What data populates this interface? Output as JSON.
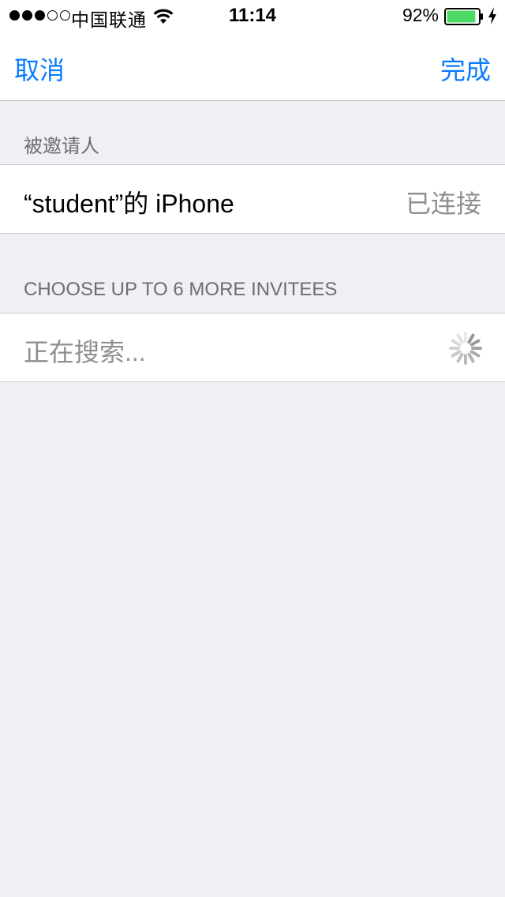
{
  "status_bar": {
    "carrier": "中国联通",
    "time": "11:14",
    "battery_percent": "92%",
    "battery_level": 0.92,
    "signal_bars": 3,
    "signal_total": 5,
    "icons": [
      "wifi-icon",
      "battery-icon",
      "charging-icon"
    ]
  },
  "nav": {
    "cancel_label": "取消",
    "done_label": "完成"
  },
  "invited_section": {
    "header": "被邀请人",
    "items": [
      {
        "name": "“student”的 iPhone",
        "status": "已连接"
      }
    ]
  },
  "more_section": {
    "header": "CHOOSE UP TO 6 MORE INVITEES",
    "searching_label": "正在搜索...",
    "icon": "spinner-icon"
  },
  "colors": {
    "accent": "#0a7aff",
    "background": "#efeff4",
    "secondary_text": "#8e8e93",
    "battery_fill": "#4cd964"
  }
}
